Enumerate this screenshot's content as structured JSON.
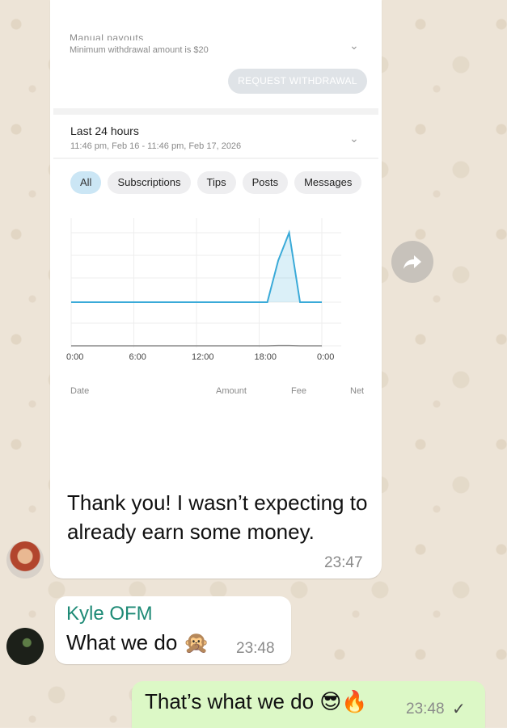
{
  "media": {
    "payout_label": "Manual payouts",
    "min_withdrawal": "Minimum withdrawal amount is $20",
    "request_btn": "REQUEST WITHDRAWAL",
    "period_title": "Last 24 hours",
    "period_range": "11:46 pm, Feb 16 - 11:46 pm, Feb 17, 2026",
    "chips": [
      "All",
      "Subscriptions",
      "Tips",
      "Posts",
      "Messages"
    ],
    "active_chip": "All",
    "x_ticks": [
      "0:00",
      "6:00",
      "12:00",
      "18:00",
      "0:00"
    ],
    "table_headers": [
      "Date",
      "Amount",
      "Fee",
      "Net"
    ]
  },
  "chart_data": {
    "type": "area",
    "x": [
      "0:00",
      "6:00",
      "12:00",
      "18:00",
      "0:00"
    ],
    "series": [
      {
        "values": [
          0,
          0,
          0,
          0,
          0,
          0,
          0,
          0,
          0,
          0,
          0,
          0,
          0,
          0,
          0,
          0,
          0,
          0,
          0,
          0.6,
          1.0,
          0,
          0,
          0
        ],
        "color": "#3aaad8"
      },
      {
        "values": [
          0,
          0,
          0,
          0,
          0,
          0,
          0,
          0,
          0,
          0,
          0,
          0,
          0,
          0,
          0,
          0,
          0,
          0,
          0,
          0.05,
          0.05,
          0,
          0,
          0
        ],
        "color": "#8a8a8a"
      }
    ],
    "grid": true
  },
  "messages": {
    "msg1_text": "Thank you! I wasn’t expecting to already earn some money.",
    "msg1_time": "23:47",
    "msg2_sender": "Kyle OFM",
    "msg2_text": "What we do 🙊",
    "msg2_time": "23:48",
    "msg3_text": "That’s what we do 😎🔥",
    "msg3_time": "23:48",
    "msg3_status": "✓"
  },
  "icons": {
    "forward": "forward-icon",
    "chevron": "chevron-down-icon"
  },
  "colors": {
    "outgoing_bubble": "#dcf8c6",
    "sender_name": "#1e8a76",
    "chart_line": "#3aaad8"
  }
}
